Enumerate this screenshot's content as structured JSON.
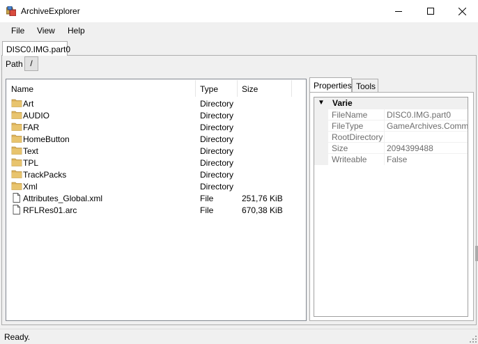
{
  "window": {
    "title": "ArchiveExplorer"
  },
  "menu": {
    "items": [
      "File",
      "View",
      "Help"
    ]
  },
  "document_tab": {
    "label": "DISC0.IMG.part0"
  },
  "path": {
    "label": "Path",
    "button": "/"
  },
  "list": {
    "columns": [
      "Name",
      "Type",
      "Size"
    ],
    "rows": [
      {
        "name": "Art",
        "type": "Directory",
        "size": "",
        "icon": "folder-icon"
      },
      {
        "name": "AUDIO",
        "type": "Directory",
        "size": "",
        "icon": "folder-icon"
      },
      {
        "name": "FAR",
        "type": "Directory",
        "size": "",
        "icon": "folder-icon"
      },
      {
        "name": "HomeButton",
        "type": "Directory",
        "size": "",
        "icon": "folder-icon"
      },
      {
        "name": "Text",
        "type": "Directory",
        "size": "",
        "icon": "folder-icon"
      },
      {
        "name": "TPL",
        "type": "Directory",
        "size": "",
        "icon": "folder-icon"
      },
      {
        "name": "TrackPacks",
        "type": "Directory",
        "size": "",
        "icon": "folder-icon"
      },
      {
        "name": "Xml",
        "type": "Directory",
        "size": "",
        "icon": "folder-icon"
      },
      {
        "name": "Attributes_Global.xml",
        "type": "File",
        "size": "251,76 KiB",
        "icon": "file-icon"
      },
      {
        "name": "RFLRes01.arc",
        "type": "File",
        "size": "670,38 KiB",
        "icon": "file-icon"
      }
    ]
  },
  "side_tabs": {
    "properties": "Properties",
    "tools": "Tools"
  },
  "properties": {
    "category": "Varie",
    "rows": [
      {
        "name": "FileName",
        "value": "DISC0.IMG.part0"
      },
      {
        "name": "FileType",
        "value": "GameArchives.Common"
      },
      {
        "name": "RootDirectory",
        "value": ""
      },
      {
        "name": "Size",
        "value": "2094399488"
      },
      {
        "name": "Writeable",
        "value": "False"
      }
    ]
  },
  "status": {
    "text": "Ready."
  },
  "colors": {
    "folder": "#dcb15a",
    "accent": "#0078d7"
  }
}
